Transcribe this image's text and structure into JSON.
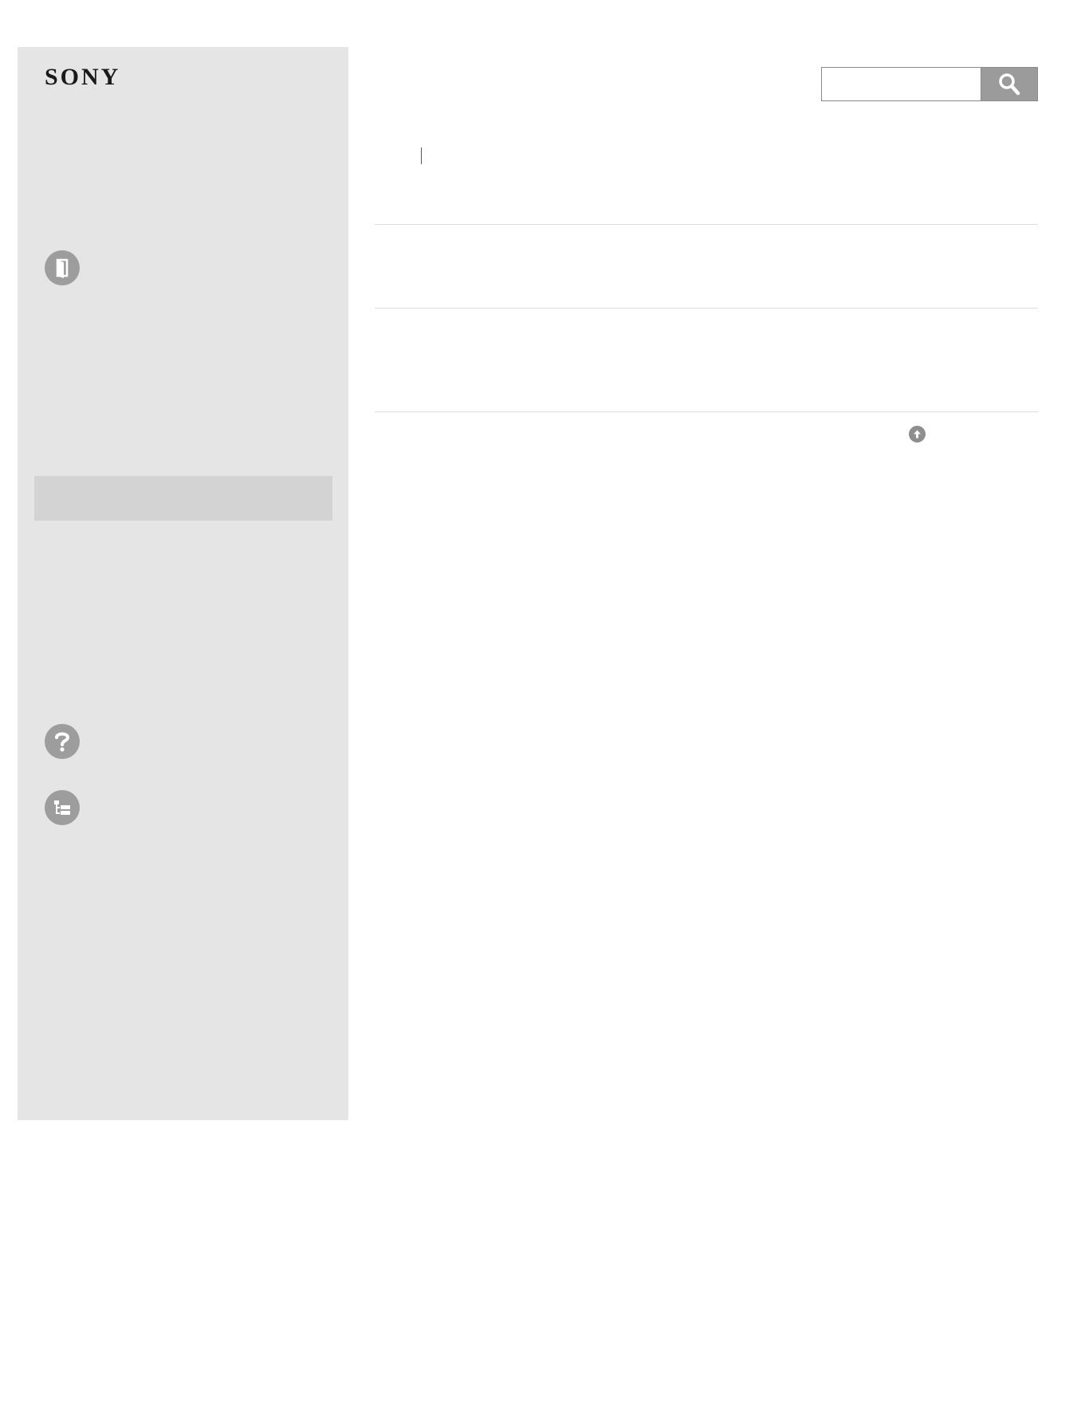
{
  "brand": {
    "logo_text": "SONY"
  },
  "sidebar": {
    "icons": {
      "manual": "book-icon",
      "help": "question-mark-icon",
      "sitemap": "sitemap-icon"
    },
    "colors": {
      "background": "#e5e5e5",
      "selected_item": "#d3d3d3",
      "icon_circle": "#9d9d9d"
    }
  },
  "search": {
    "value": "",
    "placeholder": "",
    "button_icon": "search-icon",
    "button_color": "#9b9b9b"
  },
  "page_top": {
    "icon": "arrow-up-circle-icon"
  }
}
